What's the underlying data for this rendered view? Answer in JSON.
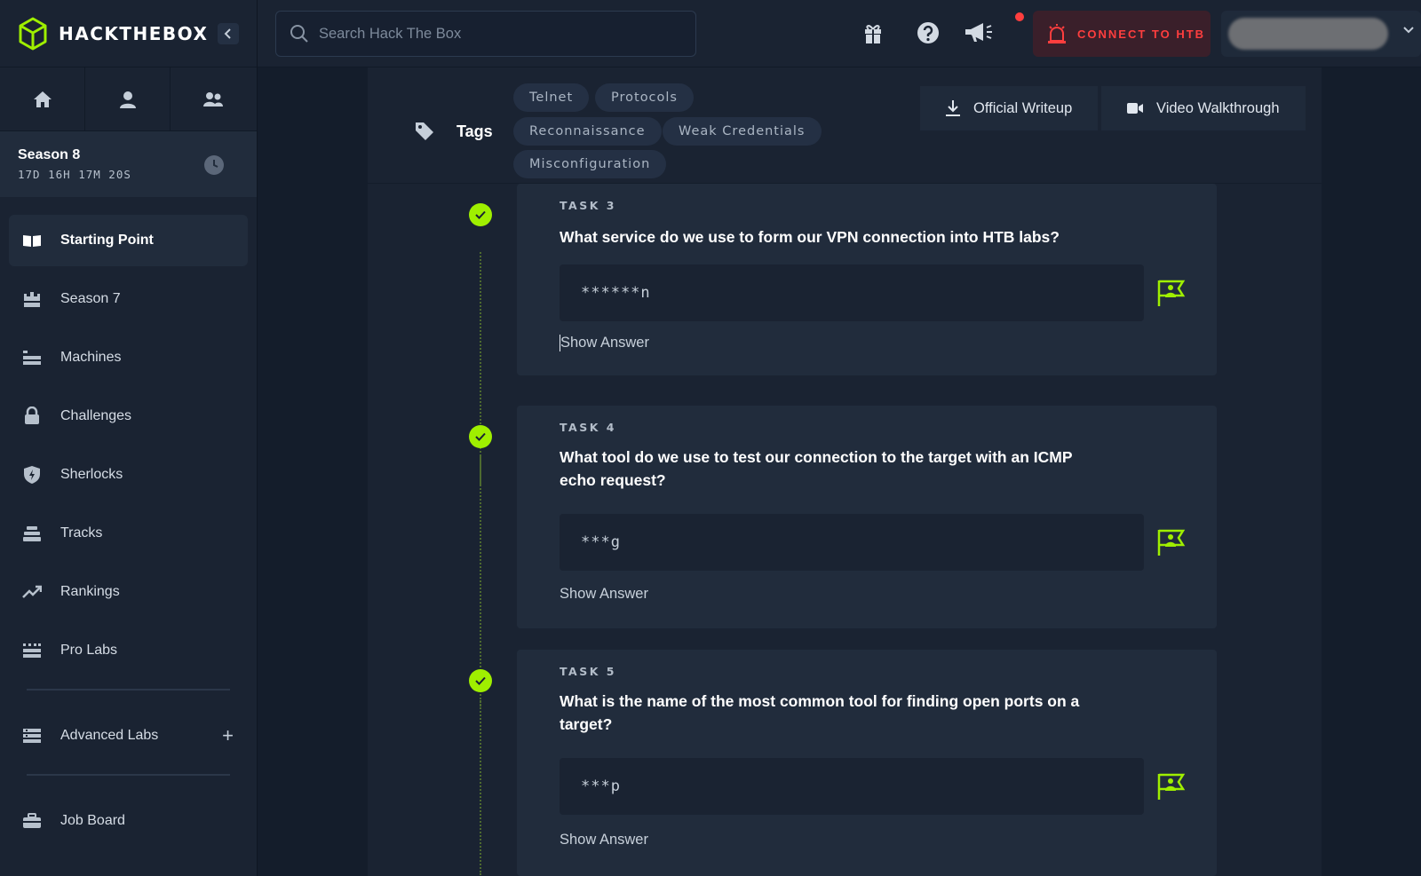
{
  "brand": {
    "name": "HACKTHEBOX"
  },
  "sidebar": {
    "season": {
      "title": "Season 8",
      "timer": "17D 16H 17M 20S"
    },
    "items": [
      {
        "label": "Starting Point",
        "icon": "book-open-icon"
      },
      {
        "label": "Season 7",
        "icon": "castle-icon"
      },
      {
        "label": "Machines",
        "icon": "server-icon"
      },
      {
        "label": "Challenges",
        "icon": "lock-icon"
      },
      {
        "label": "Sherlocks",
        "icon": "shield-icon"
      },
      {
        "label": "Tracks",
        "icon": "layers-icon"
      },
      {
        "label": "Rankings",
        "icon": "trending-up-icon"
      },
      {
        "label": "Pro Labs",
        "icon": "grid-icon"
      },
      {
        "label": "Advanced Labs",
        "icon": "stack-icon"
      },
      {
        "label": "Job Board",
        "icon": "briefcase-icon"
      }
    ]
  },
  "topbar": {
    "search_placeholder": "Search Hack The Box",
    "connect_label": "CONNECT TO HTB"
  },
  "tags": {
    "label": "Tags",
    "items": [
      "Telnet",
      "Protocols",
      "Reconnaissance",
      "Weak Credentials",
      "Misconfiguration"
    ]
  },
  "writeups": {
    "official": "Official Writeup",
    "video": "Video Walkthrough"
  },
  "tasks": [
    {
      "label": "TASK 3",
      "question": "What service do we use to form our VPN connection into HTB labs?",
      "answer_mask": "******n",
      "show_answer": "Show Answer"
    },
    {
      "label": "TASK 4",
      "question": "What tool do we use to test our connection to the target with an ICMP echo request?",
      "answer_mask": "***g",
      "show_answer": "Show Answer"
    },
    {
      "label": "TASK 5",
      "question": "What is the name of the most common tool for finding open ports on a target?",
      "answer_mask": "***p",
      "show_answer": "Show Answer"
    }
  ],
  "colors": {
    "accent": "#9fef00",
    "danger": "#ff3e3e",
    "bg": "#141d2b",
    "panel": "#1a2332"
  }
}
